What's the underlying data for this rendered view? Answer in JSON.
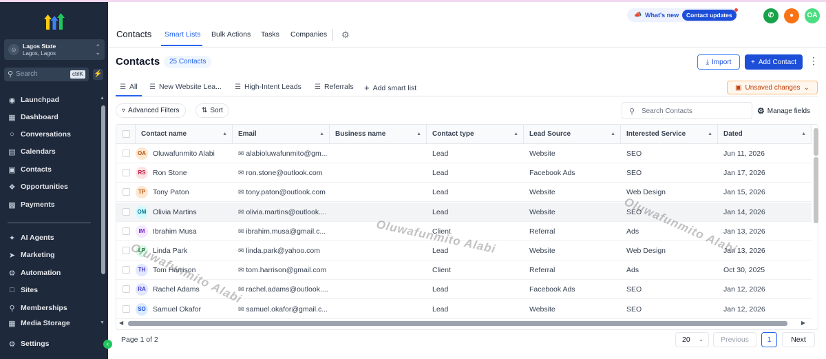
{
  "colors": {
    "accent": "#2563eb",
    "sidebar_bg": "#1e293b",
    "primary_button": "#1d4ed8",
    "unsaved_text": "#c2410c",
    "phone_button": "#16a34a",
    "bell_button": "#f97316",
    "user_avatar": "#4ade80"
  },
  "sidebar": {
    "account_name": "Lagos State",
    "account_location": "Lagos, Lagos",
    "search_placeholder": "Search",
    "search_shortcut": "ctrlK",
    "nav": [
      {
        "label": "Launchpad",
        "icon": "rocket-icon"
      },
      {
        "label": "Dashboard",
        "icon": "grid-icon"
      },
      {
        "label": "Conversations",
        "icon": "chat-icon"
      },
      {
        "label": "Calendars",
        "icon": "calendar-icon"
      },
      {
        "label": "Contacts",
        "icon": "contact-card-icon"
      },
      {
        "label": "Opportunities",
        "icon": "network-icon"
      },
      {
        "label": "Payments",
        "icon": "receipt-icon"
      },
      {
        "label": "AI Agents",
        "icon": "sparkle-icon"
      },
      {
        "label": "Marketing",
        "icon": "send-icon"
      },
      {
        "label": "Automation",
        "icon": "automation-icon"
      },
      {
        "label": "Sites",
        "icon": "sites-icon"
      },
      {
        "label": "Memberships",
        "icon": "membership-icon"
      },
      {
        "label": "Media Storage",
        "icon": "media-icon"
      },
      {
        "label": "Settings",
        "icon": "gear-icon"
      }
    ]
  },
  "topnav": {
    "title": "Contacts",
    "tabs": [
      "Smart Lists",
      "Bulk Actions",
      "Tasks",
      "Companies"
    ],
    "whats_new": "What's new",
    "contact_updates": "Contact updates",
    "user_initials": "OA"
  },
  "header": {
    "title": "Contacts",
    "count_badge": "25 Contacts",
    "import_label": "Import",
    "add_contact_label": "Add Contact"
  },
  "smart_lists": {
    "tabs": [
      "All",
      "New Website Lea...",
      "High-Intent Leads",
      "Referrals"
    ],
    "add_label": "Add smart list",
    "unsaved_label": "Unsaved changes"
  },
  "filters": {
    "advanced_label": "Advanced Filters",
    "sort_label": "Sort",
    "search_placeholder": "Search Contacts",
    "manage_fields_label": "Manage fields"
  },
  "table": {
    "columns": [
      "Contact name",
      "Email",
      "Business name",
      "Contact type",
      "Lead Source",
      "Interested Service",
      "Dated"
    ],
    "rows": [
      {
        "initials": "OA",
        "name": "Oluwafunmito Alabi",
        "email": "alabioluwafunmito@gm...",
        "business": "",
        "type": "Lead",
        "source": "Website",
        "service": "SEO",
        "date": "Jun 11, 2026"
      },
      {
        "initials": "RS",
        "name": "Ron Stone",
        "email": "ron.stone@outlook.com",
        "business": "",
        "type": "Lead",
        "source": "Facebook Ads",
        "service": "SEO",
        "date": "Jan 17, 2026"
      },
      {
        "initials": "TP",
        "name": "Tony Paton",
        "email": "tony.paton@outlook.com",
        "business": "",
        "type": "Lead",
        "source": "Website",
        "service": "Web Design",
        "date": "Jan 15, 2026"
      },
      {
        "initials": "OM",
        "name": "Olivia Martins",
        "email": "olivia.martins@outlook....",
        "business": "",
        "type": "Lead",
        "source": "Website",
        "service": "SEO",
        "date": "Jan 14, 2026"
      },
      {
        "initials": "IM",
        "name": "Ibrahim Musa",
        "email": "ibrahim.musa@gmail.c...",
        "business": "",
        "type": "Client",
        "source": "Referral",
        "service": "Ads",
        "date": "Jan 13, 2026"
      },
      {
        "initials": "LP",
        "name": "Linda Park",
        "email": "linda.park@yahoo.com",
        "business": "",
        "type": "Lead",
        "source": "Website",
        "service": "Web Design",
        "date": "Jan 13, 2026"
      },
      {
        "initials": "TH",
        "name": "Tom Harrison",
        "email": "tom.harrison@gmail.com",
        "business": "",
        "type": "Client",
        "source": "Referral",
        "service": "Ads",
        "date": "Oct 30, 2025"
      },
      {
        "initials": "RA",
        "name": "Rachel Adams",
        "email": "rachel.adams@outlook....",
        "business": "",
        "type": "Lead",
        "source": "Facebook Ads",
        "service": "SEO",
        "date": "Jan 12, 2026"
      },
      {
        "initials": "SO",
        "name": "Samuel Okafor",
        "email": "samuel.okafor@gmail.c...",
        "business": "",
        "type": "Lead",
        "source": "Website",
        "service": "SEO",
        "date": "Jan 12, 2026"
      }
    ]
  },
  "pagination": {
    "page_info": "Page 1 of 2",
    "page_size": "20",
    "previous_label": "Previous",
    "current_page": "1",
    "next_label": "Next"
  },
  "watermark": "Oluwafunmito Alabi"
}
